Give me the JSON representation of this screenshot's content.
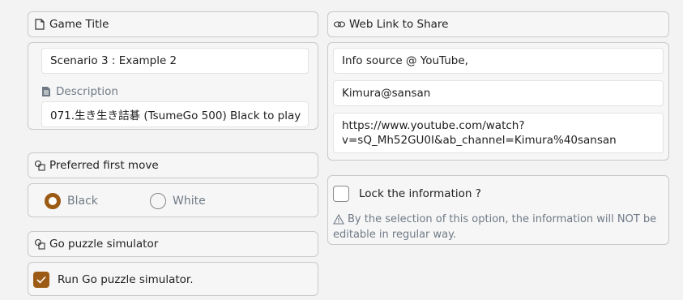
{
  "left": {
    "game_title": {
      "header": "Game Title",
      "title_value": "Scenario 3 : Example 2",
      "description_label": "Description",
      "description_value": "071.生き生き詰碁 (TsumeGo 500) Black to play"
    },
    "preferred_first_move": {
      "header": "Preferred first move",
      "options": [
        "Black",
        "White"
      ],
      "selected": "Black"
    },
    "go_puzzle_simulator": {
      "header": "Go puzzle simulator",
      "checkbox_label": "Run Go puzzle simulator.",
      "checked": true
    }
  },
  "right": {
    "web_link": {
      "header": "Web Link to Share",
      "line1": "Info source @ YouTube,",
      "line2": "Kimura@sansan",
      "url_line1": "https://www.youtube.com/watch?",
      "url_line2": "v=sQ_Mh52GU0I&ab_channel=Kimura%40sansan"
    },
    "lock": {
      "checkbox_label": "Lock the information ?",
      "checked": false,
      "warning_line1": "By the selection of this option, the information will NOT be",
      "warning_line2": "editable in regular way."
    }
  },
  "colors": {
    "accent": "#9c5b14",
    "muted_text": "#6f7a86"
  },
  "icons": {
    "game_title": "document-icon",
    "description": "list-document-icon",
    "web_link": "link-icon",
    "first_move": "shapes-icon",
    "simulator": "shapes-icon",
    "warning": "warning-icon",
    "check": "checkmark-icon"
  }
}
